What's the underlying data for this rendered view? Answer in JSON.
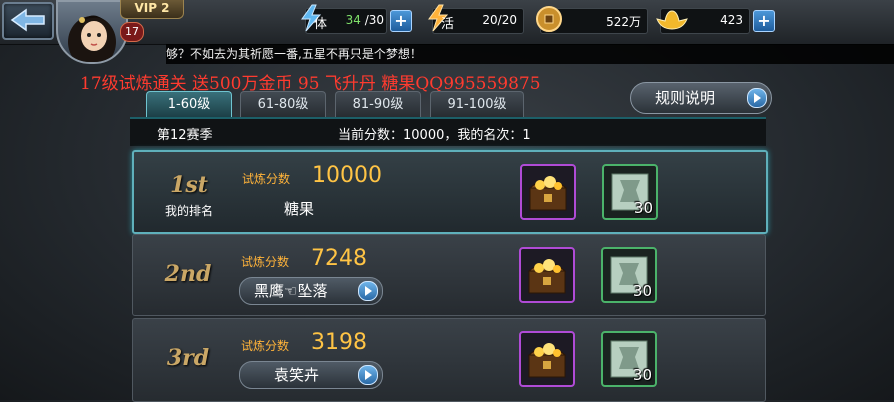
{
  "header": {
    "vip_label": "VIP 2",
    "player_level": "17",
    "stamina": {
      "icon": "lightning-icon",
      "label": "体",
      "current": "34",
      "max": "/30"
    },
    "vitality": {
      "icon": "lightning-icon",
      "label": "活",
      "value": "20/20"
    },
    "coins": {
      "icon": "coin-icon",
      "value": "522万"
    },
    "gold": {
      "icon": "gold-ingot-icon",
      "value": "423"
    }
  },
  "marquee_text": "够？不如去为其祈愿一番,五星不再只是个梦想！",
  "promo_text": "17级试炼通关 送500万金币  95 飞升丹  糖果QQ995559875",
  "tabs": [
    {
      "label": "1-60级",
      "active": true
    },
    {
      "label": "61-80级",
      "active": false
    },
    {
      "label": "81-90级",
      "active": false
    },
    {
      "label": "91-100级",
      "active": false
    }
  ],
  "rules_button": "规则说明",
  "season": {
    "name": "第12赛季",
    "summary": "当前分数：10000，我的名次：1"
  },
  "score_label": "试炼分数",
  "ranks": [
    {
      "rank": "1st",
      "sub": "我的排名",
      "score": "10000",
      "player": "糖果",
      "chest_qty": "",
      "scroll_qty": "30"
    },
    {
      "rank": "2nd",
      "sub": "",
      "score": "7248",
      "player": "黑鹰☜坠落",
      "chest_qty": "",
      "scroll_qty": "30"
    },
    {
      "rank": "3rd",
      "sub": "",
      "score": "3198",
      "player": "袁笑卉",
      "chest_qty": "",
      "scroll_qty": "30"
    }
  ],
  "colors": {
    "accent_teal": "#5fb0bb",
    "score_gold": "#ffc445",
    "promo_red": "#ff3b2f",
    "chest_border": "#b04bd6",
    "scroll_border": "#4bb36a"
  }
}
